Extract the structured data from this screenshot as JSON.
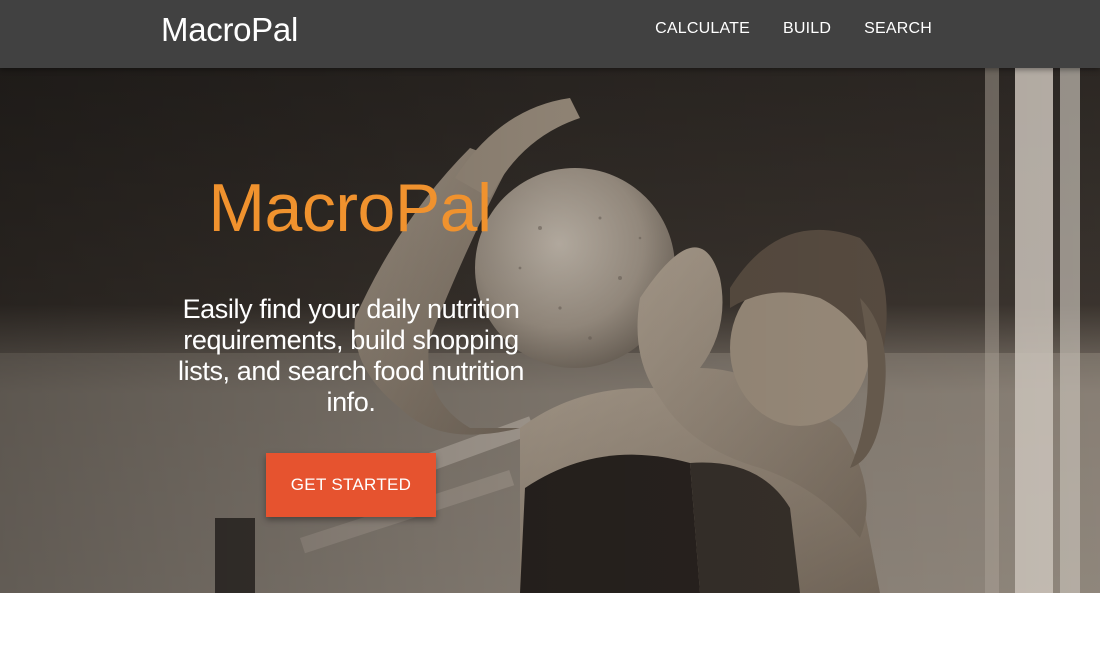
{
  "navbar": {
    "brand": "MacroPal",
    "links": [
      "CALCULATE",
      "BUILD",
      "SEARCH"
    ],
    "background": "#414141"
  },
  "hero": {
    "title": "MacroPal",
    "subtitle": "Easily find your daily nutrition requirements, build shopping lists, and search food nutrition info.",
    "cta_label": "GET STARTED",
    "title_color": "#f0922e",
    "cta_color": "#e6532f",
    "background_image": "woman-lifting-medicine-ball-photo"
  }
}
